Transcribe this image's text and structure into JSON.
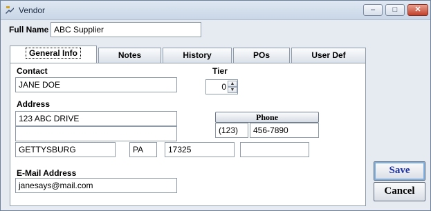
{
  "window": {
    "title": "Vendor",
    "controls": {
      "minimize": "–",
      "maximize": "□",
      "close": "✕"
    }
  },
  "full_name": {
    "label": "Full Name",
    "value": "ABC Supplier"
  },
  "tabs": [
    {
      "label": "General Info",
      "active": true
    },
    {
      "label": "Notes",
      "active": false
    },
    {
      "label": "History",
      "active": false
    },
    {
      "label": "POs",
      "active": false
    },
    {
      "label": "User Def",
      "active": false
    }
  ],
  "general": {
    "contact": {
      "label": "Contact",
      "value": "JANE DOE"
    },
    "tier": {
      "label": "Tier",
      "value": "0"
    },
    "address": {
      "label": "Address",
      "line1": "123 ABC DRIVE",
      "line2": "",
      "city": "GETTYSBURG",
      "state": "PA",
      "zip": "17325",
      "extra": ""
    },
    "phone": {
      "button_label": "Phone",
      "area_code": "(123)",
      "number": "456-7890"
    },
    "email": {
      "label": "E-Mail Address",
      "value": "janesays@mail.com"
    }
  },
  "buttons": {
    "save": "Save",
    "cancel": "Cancel"
  },
  "colors": {
    "save_text": "#1b2fa0",
    "close_button": "#c2412b",
    "titlebar": "#c9d6e6"
  }
}
